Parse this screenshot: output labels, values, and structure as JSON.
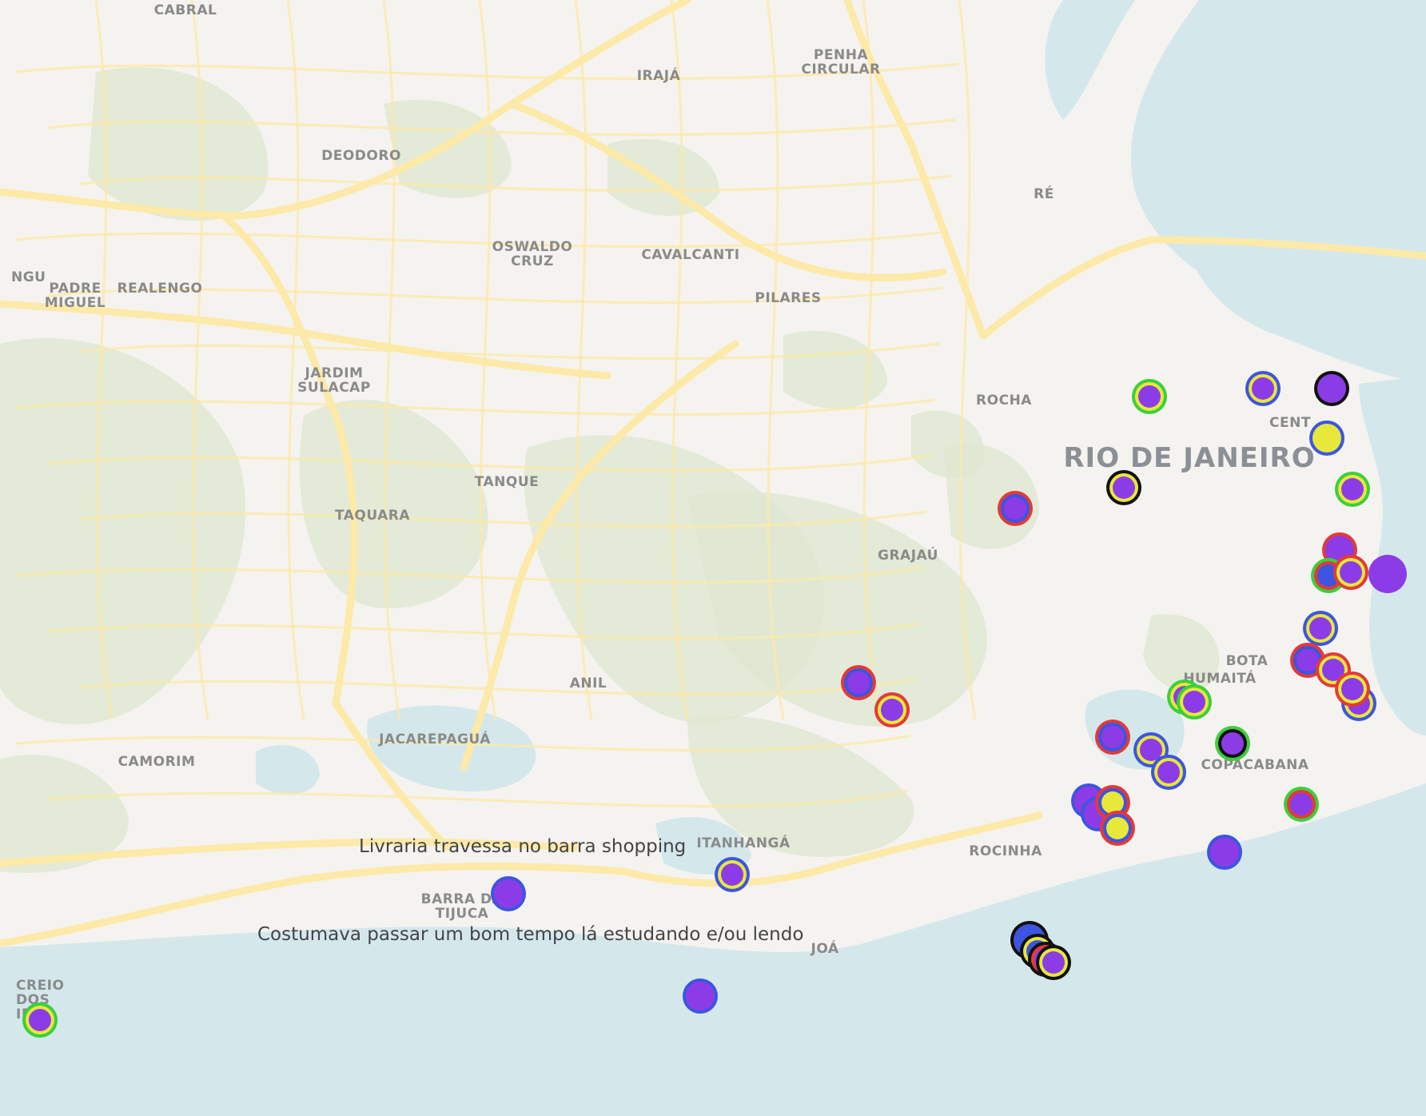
{
  "colors": {
    "land": "#f5f3ef",
    "water": "#d4e8ec",
    "green": "#dfe8d2",
    "road": "#fde9a8",
    "purple": "#8c3ce6",
    "yellow": "#e8e83a",
    "red": "#e23a3a",
    "green_ring": "#3ccf3c",
    "blue": "#3d55e0",
    "black": "#111111"
  },
  "city_label": "RIO DE JANEIRO",
  "places": [
    {
      "lines": [
        "CABRAL"
      ]
    },
    {
      "lines": [
        "IRAJÁ"
      ]
    },
    {
      "lines": [
        "PENHA",
        "CIRCULAR"
      ]
    },
    {
      "lines": [
        "DEODORO"
      ]
    },
    {
      "lines": [
        "OSWALDO",
        "CRUZ"
      ]
    },
    {
      "lines": [
        "CAVALCANTI"
      ]
    },
    {
      "lines": [
        "NGU"
      ]
    },
    {
      "lines": [
        "PADRE",
        "MIGUEL"
      ]
    },
    {
      "lines": [
        "REALENGO"
      ]
    },
    {
      "lines": [
        "PILARES"
      ]
    },
    {
      "lines": [
        "JARDIM",
        "SULACAP"
      ]
    },
    {
      "lines": [
        "ROCHA"
      ]
    },
    {
      "lines": [
        "TANQUE"
      ]
    },
    {
      "lines": [
        "TAQUARA"
      ]
    },
    {
      "lines": [
        "GRAJAÚ"
      ]
    },
    {
      "lines": [
        "ANIL"
      ]
    },
    {
      "lines": [
        "JACAREPAGUÁ"
      ]
    },
    {
      "lines": [
        "CAMORIM"
      ]
    },
    {
      "lines": [
        "ITANHANGÁ"
      ]
    },
    {
      "lines": [
        "ROCINHA"
      ]
    },
    {
      "lines": [
        "JOÁ"
      ]
    },
    {
      "lines": [
        "COPACABANA"
      ]
    },
    {
      "lines": [
        "HUMAITÁ"
      ]
    },
    {
      "lines": [
        "BOTA"
      ]
    },
    {
      "lines": [
        "CENT"
      ]
    },
    {
      "lines": [
        "RÉ"
      ]
    },
    {
      "lines": [
        "BARRA DA",
        "TIJUCA"
      ]
    },
    {
      "lines": [
        "CREIO",
        "DOS",
        "IRA"
      ]
    }
  ],
  "tooltip": {
    "title": "Livraria travessa no barra shopping",
    "body": "Costumava passar um bom tempo lá estudando e/ou lendo"
  },
  "markers": [
    {
      "ring": "green",
      "inner": "yellow",
      "core": "purple"
    },
    {
      "ring": "blue",
      "inner": "yellow",
      "core": "purple"
    },
    {
      "ring": "black",
      "inner": "none",
      "core": "purple"
    },
    {
      "ring": "blue",
      "inner": "none",
      "core": "yellow"
    },
    {
      "ring": "black",
      "inner": "yellow",
      "core": "purple"
    },
    {
      "ring": "green",
      "inner": "yellow",
      "core": "purple"
    },
    {
      "ring": "red",
      "inner": "blue",
      "core": "purple"
    },
    {
      "ring": "red",
      "inner": "none",
      "core": "purple"
    },
    {
      "ring": "green",
      "inner": "red",
      "core": "blue"
    },
    {
      "ring": "red",
      "inner": "yellow",
      "core": "purple"
    },
    {
      "ring": "none",
      "inner": "none",
      "core": "purple"
    },
    {
      "ring": "blue",
      "inner": "yellow",
      "core": "purple"
    },
    {
      "ring": "red",
      "inner": "blue",
      "core": "purple"
    },
    {
      "ring": "red",
      "inner": "yellow",
      "core": "purple"
    },
    {
      "ring": "blue",
      "inner": "yellow",
      "core": "purple"
    },
    {
      "ring": "red",
      "inner": "yellow",
      "core": "purple"
    },
    {
      "ring": "red",
      "inner": "blue",
      "core": "purple"
    },
    {
      "ring": "red",
      "inner": "yellow",
      "core": "purple"
    },
    {
      "ring": "green",
      "inner": "yellow",
      "core": "purple"
    },
    {
      "ring": "green",
      "inner": "yellow",
      "core": "purple"
    },
    {
      "ring": "red",
      "inner": "blue",
      "core": "purple"
    },
    {
      "ring": "blue",
      "inner": "yellow",
      "core": "purple"
    },
    {
      "ring": "blue",
      "inner": "yellow",
      "core": "purple"
    },
    {
      "ring": "green",
      "inner": "black",
      "core": "purple"
    },
    {
      "ring": "blue",
      "inner": "none",
      "core": "purple"
    },
    {
      "ring": "blue",
      "inner": "none",
      "core": "purple"
    },
    {
      "ring": "red",
      "inner": "blue",
      "core": "yellow"
    },
    {
      "ring": "red",
      "inner": "blue",
      "core": "yellow"
    },
    {
      "ring": "green",
      "inner": "red",
      "core": "purple"
    },
    {
      "ring": "blue",
      "inner": "none",
      "core": "purple"
    },
    {
      "ring": "blue",
      "inner": "yellow",
      "core": "purple"
    },
    {
      "ring": "blue",
      "inner": "none",
      "core": "purple"
    },
    {
      "ring": "blue",
      "inner": "none",
      "core": "purple"
    },
    {
      "ring": "black",
      "inner": "none",
      "core": "blue"
    },
    {
      "ring": "black",
      "inner": "yellow",
      "core": "blue"
    },
    {
      "ring": "black",
      "inner": "red",
      "core": "purple"
    },
    {
      "ring": "black",
      "inner": "yellow",
      "core": "purple"
    },
    {
      "ring": "green",
      "inner": "yellow",
      "core": "purple"
    }
  ]
}
